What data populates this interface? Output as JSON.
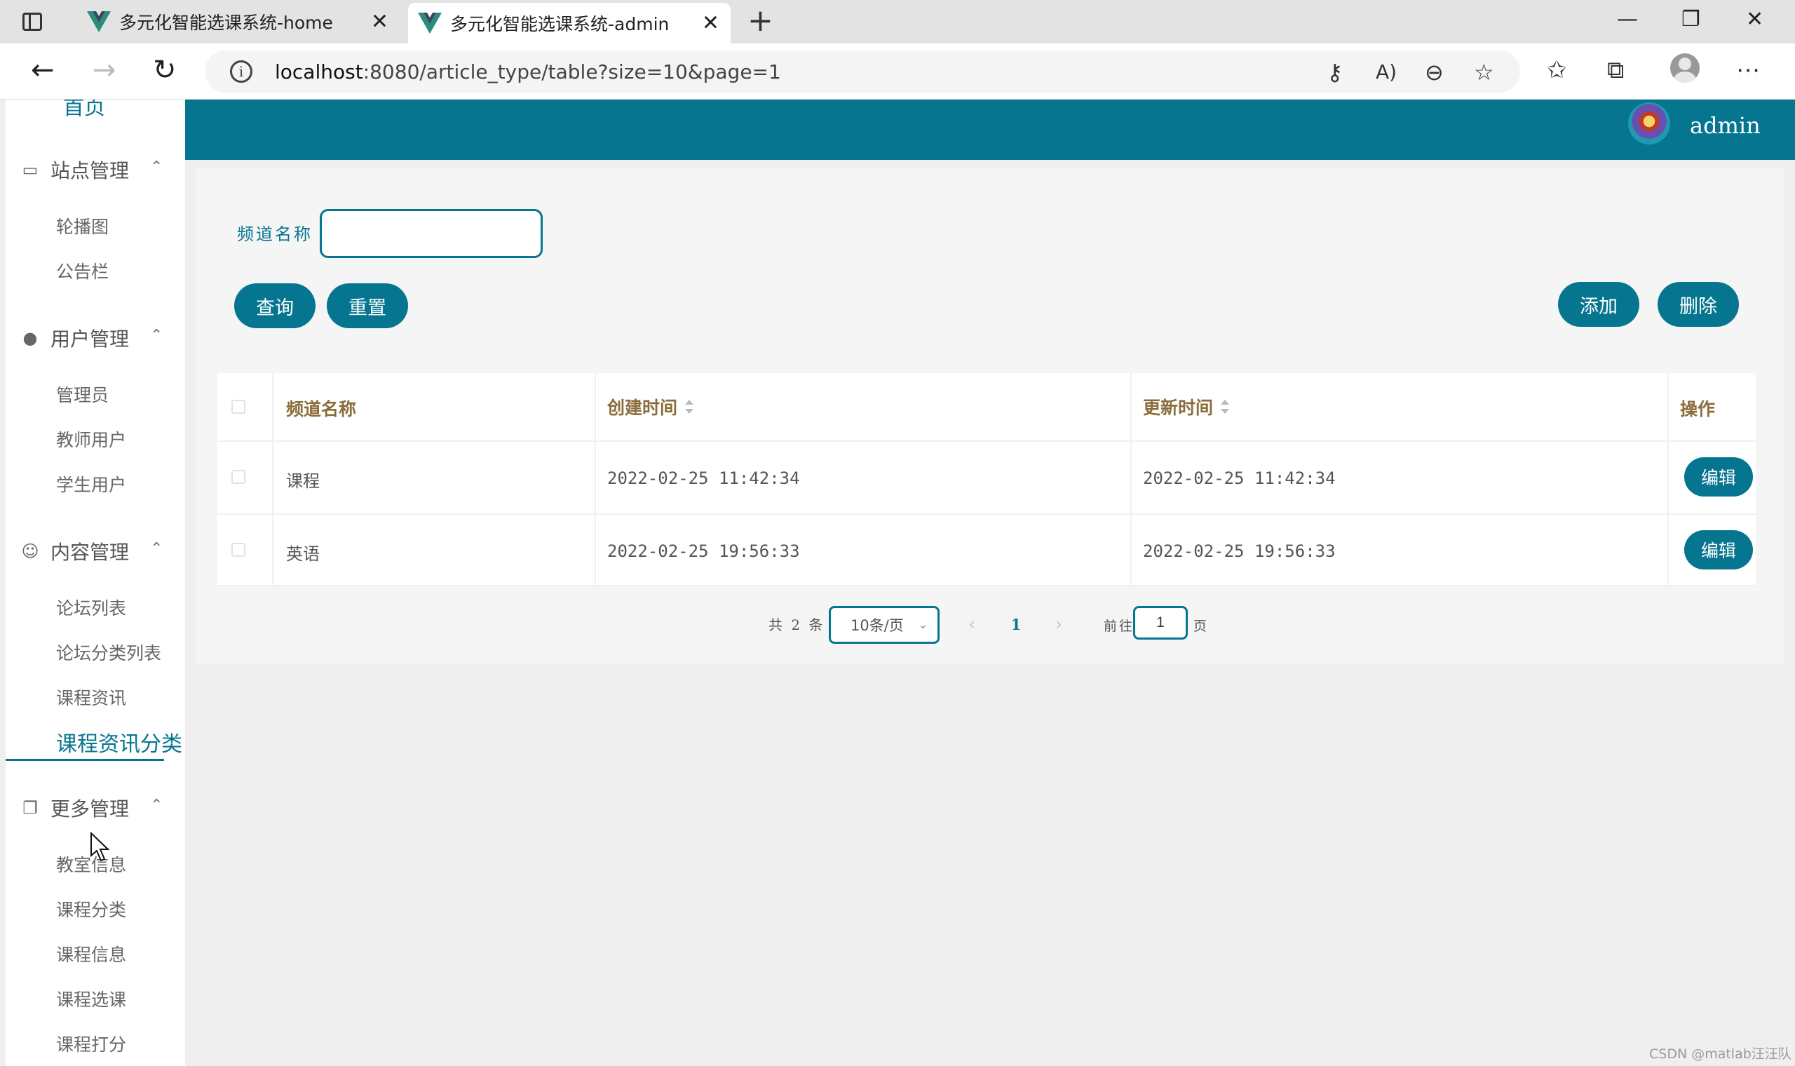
{
  "browser": {
    "tabs": [
      {
        "title": "多元化智能选课系统-home"
      },
      {
        "title": "多元化智能选课系统-admin"
      }
    ],
    "url_host": "localhost",
    "url_rest": ":8080/article_type/table?size=10&page=1"
  },
  "sidebar": {
    "home_label": "首页",
    "groups": [
      {
        "label": "站点管理",
        "icon": "monitor-icon",
        "items": [
          "轮播图",
          "公告栏"
        ]
      },
      {
        "label": "用户管理",
        "icon": "user-icon",
        "items": [
          "管理员",
          "教师用户",
          "学生用户"
        ]
      },
      {
        "label": "内容管理",
        "icon": "chat-icon",
        "items": [
          "论坛列表",
          "论坛分类列表",
          "课程资讯",
          "课程资讯分类"
        ]
      },
      {
        "label": "更多管理",
        "icon": "copy-icon",
        "items": [
          "教室信息",
          "课程分类",
          "课程信息",
          "课程选课",
          "课程打分"
        ]
      }
    ],
    "active_item": "课程资讯分类"
  },
  "header": {
    "username": "admin"
  },
  "search": {
    "label": "频道名称",
    "value": "",
    "placeholder": ""
  },
  "buttons": {
    "query": "查询",
    "reset": "重置",
    "add": "添加",
    "delete": "删除",
    "edit": "编辑"
  },
  "table": {
    "columns": [
      "频道名称",
      "创建时间",
      "更新时间",
      "操作"
    ],
    "rows": [
      {
        "name": "课程",
        "created": "2022-02-25 11:42:34",
        "updated": "2022-02-25 11:42:34"
      },
      {
        "name": "英语",
        "created": "2022-02-25 19:56:33",
        "updated": "2022-02-25 19:56:33"
      }
    ]
  },
  "pagination": {
    "total_text": "共 2 条",
    "page_size": "10条/页",
    "current_page": "1",
    "goto_label": "前往",
    "goto_value": "1",
    "page_suffix": "页"
  },
  "watermark": "CSDN @matlab汪汪队",
  "colors": {
    "primary": "#06758f",
    "header_text": "#8a6d3b"
  }
}
